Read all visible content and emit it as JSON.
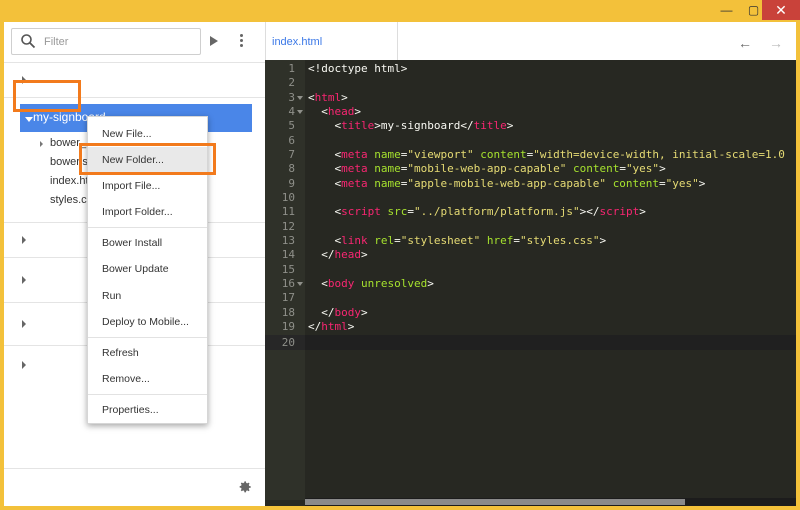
{
  "window": {
    "minimize": "—",
    "maximize": "▢",
    "close": "✕"
  },
  "sidebar": {
    "search_placeholder": "Filter",
    "project": "my-signboard",
    "files": [
      "bower_",
      "bower.s",
      "index.htm",
      "styles.css"
    ]
  },
  "context_menu": {
    "items": [
      "New File...",
      "New Folder...",
      "Import File...",
      "Import Folder...",
      "Bower Install",
      "Bower Update",
      "Run",
      "Deploy to Mobile...",
      "Refresh",
      "Remove...",
      "Properties..."
    ],
    "selected": "New Folder..."
  },
  "editor": {
    "tab": "index.html",
    "nav_back": "←",
    "nav_forward": "→",
    "line_numbers": [
      "1",
      "2",
      "3",
      "4",
      "5",
      "6",
      "7",
      "8",
      "9",
      "10",
      "11",
      "12",
      "13",
      "14",
      "15",
      "16",
      "17",
      "18",
      "19",
      "20"
    ]
  },
  "colors": {
    "accent": "#4a86e8",
    "highlight": "#f27a1c",
    "editor_bg": "#272822"
  }
}
